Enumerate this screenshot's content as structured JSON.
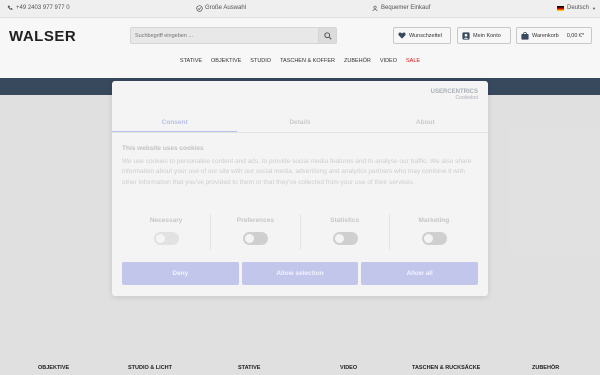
{
  "topbar": {
    "phone": "+49 2403 977 977 0",
    "selection": "Große Auswahl",
    "shopping": "Bequemer Einkauf",
    "language": "Deutsch"
  },
  "header": {
    "logo": "WALSER",
    "search_placeholder": "Suchbegriff eingeben ...",
    "wishlist": "Wunschzettel",
    "account": "Mein Konto",
    "cart": "Warenkorb",
    "cart_total": "0,00 €*"
  },
  "nav": [
    "STATIVE",
    "OBJEKTIVE",
    "STUDIO",
    "TASCHEN & KOFFER",
    "ZUBEHÖR",
    "VIDEO",
    "SALE"
  ],
  "cookie": {
    "logo_main": "USERCENTRICS",
    "logo_sub": "Cookiebot",
    "tabs": [
      "Consent",
      "Details",
      "About"
    ],
    "title": "This website uses cookies",
    "text": "We use cookies to personalise content and ads, to provide social media features and to analyse our traffic. We also share information about your use of our site with our social media, advertising and analytics partners who may combine it with other information that you've provided to them or that they've collected from your use of their services.",
    "categories": [
      "Necessary",
      "Preferences",
      "Statistics",
      "Marketing"
    ],
    "buttons": {
      "deny": "Deny",
      "allow_selection": "Allow selection",
      "allow_all": "Allow all"
    }
  },
  "footer": [
    "OBJEKTIVE",
    "STUDIO & LICHT",
    "STATIVE",
    "VIDEO",
    "TASCHEN & RUCKSÄCKE",
    "ZUBEHÖR"
  ]
}
